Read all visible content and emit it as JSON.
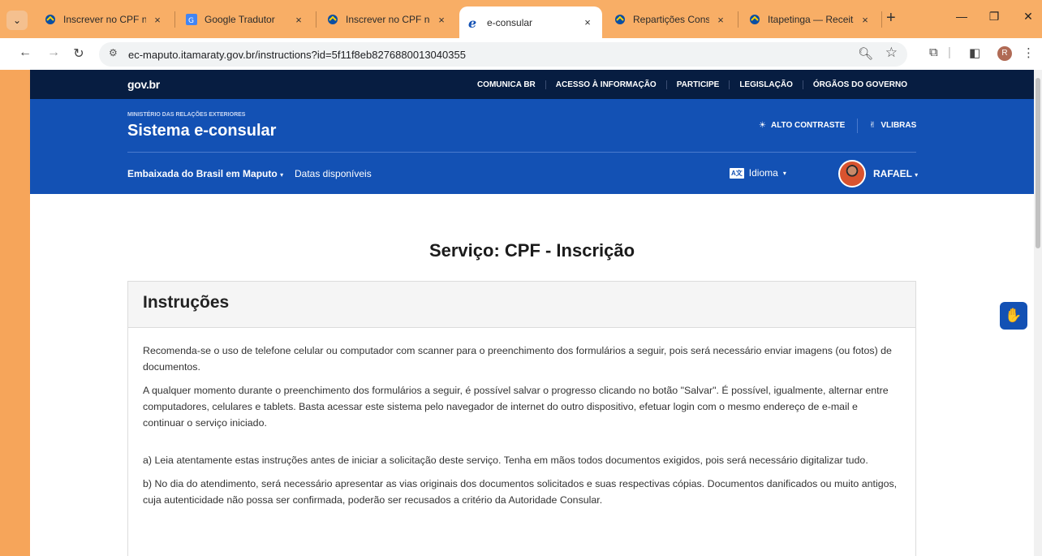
{
  "browser": {
    "tabs": [
      {
        "title": "Inscrever no CPF no e",
        "favicon": "govbr-icon",
        "active": false
      },
      {
        "title": "Google Tradutor",
        "favicon": "translate-icon",
        "active": false
      },
      {
        "title": "Inscrever no CPF no e",
        "favicon": "govbr-icon",
        "active": false
      },
      {
        "title": "e-consular",
        "favicon": "e-consular-icon",
        "active": true
      },
      {
        "title": "Repartições Consular",
        "favicon": "govbr-icon",
        "active": false
      },
      {
        "title": "Itapetinga — Receita",
        "favicon": "govbr-icon",
        "active": false
      }
    ],
    "close_glyph": "×",
    "url": "ec-maputo.itamaraty.gov.br/instructions?id=5f11f8eb8276880013040355",
    "profile_initial": "R"
  },
  "gov": {
    "logo": "gov.br",
    "links": [
      "COMUNICA BR",
      "ACESSO À INFORMAÇÃO",
      "PARTICIPE",
      "LEGISLAÇÃO",
      "ÓRGÃOS DO GOVERNO"
    ]
  },
  "header": {
    "ministry": "MINISTÉRIO DAS RELAÇÕES EXTERIORES",
    "system_title": "Sistema e-consular",
    "high_contrast": "ALTO CONTRASTE",
    "vlibras": "VLIBRAS",
    "embassy": "Embaixada do Brasil em Maputo",
    "dates": "Datas disponíveis",
    "language": "Idioma",
    "language_icon": "A文",
    "user": "RAFAEL"
  },
  "main": {
    "title": "Serviço: CPF - Inscrição",
    "card_title": "Instruções",
    "paragraphs": [
      "Recomenda-se o uso de telefone celular ou computador com scanner para o preenchimento dos formulários a seguir, pois será necessário enviar imagens (ou fotos) de documentos.",
      "A qualquer momento durante o preenchimento dos formulários a seguir, é possível salvar o progresso clicando no botão \"Salvar\". É possível, igualmente, alternar entre computadores, celulares e tablets. Basta acessar este sistema pelo navegador de internet do outro dispositivo, efetuar login com o mesmo endereço de e-mail e continuar o serviço iniciado.",
      "a) Leia atentamente estas instruções antes de iniciar a solicitação deste serviço. Tenha em mãos todos documentos exigidos, pois será necessário digitalizar tudo.",
      "b) No dia do atendimento, será necessário apresentar as vias originais dos documentos solicitados e suas respectivas cópias. Documentos danificados ou muito antigos, cuja autenticidade não possa ser confirmada, poderão ser recusados a critério da Autoridade Consular."
    ]
  },
  "colors": {
    "gov_bar": "#071d41",
    "header_blue": "#1351b4",
    "tabbar": "#f8ae66"
  }
}
